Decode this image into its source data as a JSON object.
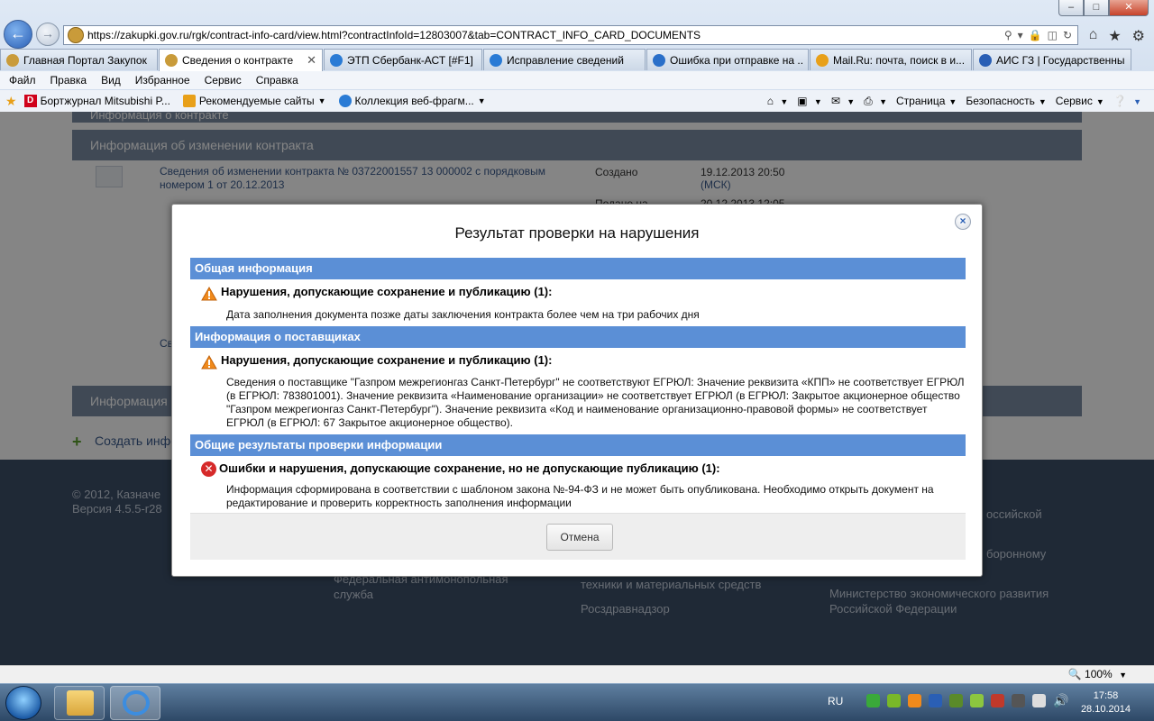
{
  "browser": {
    "window_buttons": {
      "minimize": "–",
      "maximize": "□",
      "close": "✕"
    },
    "address": {
      "url": "https://zakupki.gov.ru/rgk/contract-info-card/view.html?contractInfoId=12803007&tab=CONTRACT_INFO_CARD_DOCUMENTS"
    },
    "tabs": [
      {
        "label": "Главная Портал Закупок",
        "icon": "emblem-icon",
        "color": "#c99b3a"
      },
      {
        "label": "Сведения о контракте",
        "icon": "emblem-icon",
        "color": "#c99b3a",
        "active": true
      },
      {
        "label": "ЭТП Сбербанк-АСТ [#F1]",
        "icon": "ie-icon",
        "color": "#2a7bd5"
      },
      {
        "label": "Исправление сведений",
        "icon": "ie-icon",
        "color": "#2a7bd5"
      },
      {
        "label": "Ошибка при отправке на ...",
        "icon": "help-icon",
        "color": "#2a6fc9"
      },
      {
        "label": "Mail.Ru: почта, поиск в и...",
        "icon": "mail-icon",
        "color": "#e8a019"
      },
      {
        "label": "АИС ГЗ | Государственны...",
        "icon": "ais-icon",
        "color": "#2a5fb5"
      }
    ],
    "menu": [
      "Файл",
      "Правка",
      "Вид",
      "Избранное",
      "Сервис",
      "Справка"
    ],
    "favorites": [
      {
        "label": "Бортжурнал Mitsubishi P...",
        "icon": "drive-icon",
        "color": "#d0021b"
      },
      {
        "label": "Рекомендуемые сайты",
        "icon": "suggested-sites-icon",
        "color": "#e8a019"
      },
      {
        "label": "Коллекция веб-фрагм...",
        "icon": "web-slice-icon",
        "color": "#2a7bd5"
      }
    ],
    "commands": [
      "Страница",
      "Безопасность",
      "Сервис"
    ],
    "zoom": "100%"
  },
  "page": {
    "header_top": "Информация о контракте",
    "section_changes": "Информация об изменении контракта",
    "change_link": "Сведения об изменении контракта № 03722001557 13 000002 с порядковым номером 1 от 20.12.2013",
    "created_label": "Создано",
    "created_date": "19.12.2013 20:50",
    "created_tz": "(МСК)",
    "placed_label": "Подано на",
    "placed_date": "20.12.2013 12:05",
    "partial_link": "Све",
    "section_docs": "Информация о",
    "create_link": "Создать инфо",
    "footer": {
      "copyright": "© 2012, Казначе",
      "version": "Версия 4.5.5-r28",
      "col1": "Федеральная антимонопольная служба",
      "col2a": "техники и материальных средств",
      "col2b": "Росздравнадзор",
      "col3a": "оссийской",
      "col3b": "боронному",
      "col3c": "Министерство экономического развития Российской Федерации"
    }
  },
  "dialog": {
    "title": "Результат проверки на нарушения",
    "close_label": "×",
    "sections": [
      {
        "header": "Общая информация",
        "severity": "warning",
        "message_title": "Нарушения, допускающие сохранение и публикацию (1):",
        "message_body": "Дата заполнения документа позже даты заключения контракта более чем на три рабочих дня"
      },
      {
        "header": "Информация о поставщиках",
        "severity": "warning",
        "message_title": "Нарушения, допускающие сохранение и публикацию (1):",
        "message_body": "Сведения о поставщике \"Газпром межрегионгаз Санкт-Петербург\" не соответствуют ЕГРЮЛ: Значение реквизита «КПП» не соответствует ЕГРЮЛ (в ЕГРЮЛ: 783801001). Значение реквизита «Наименование организации» не соответствует ЕГРЮЛ (в ЕГРЮЛ: Закрытое акционерное общество \"Газпром межрегионгаз Санкт-Петербург\"). Значение реквизита «Код и наименование организационно-правовой формы» не соответствует ЕГРЮЛ (в ЕГРЮЛ: 67 Закрытое акционерное общество)."
      },
      {
        "header": "Общие результаты проверки информации",
        "severity": "error",
        "message_title": "Ошибки и нарушения, допускающие сохранение, но не допускающие публикацию (1):",
        "message_body": "Информация сформирована в соответствии с шаблоном закона №-94-ФЗ и не может быть опубликована. Необходимо открыть документ на редактирование и проверить корректность заполнения информации"
      }
    ],
    "cancel_label": "Отмена"
  },
  "taskbar": {
    "language": "RU",
    "time": "17:58",
    "date": "28.10.2014"
  },
  "colors": {
    "section_header": "#5b8fd6",
    "warning": "#f08a1c",
    "error": "#d62a2a",
    "page_header": "#7c8da3",
    "footer": "#3d4f68"
  }
}
